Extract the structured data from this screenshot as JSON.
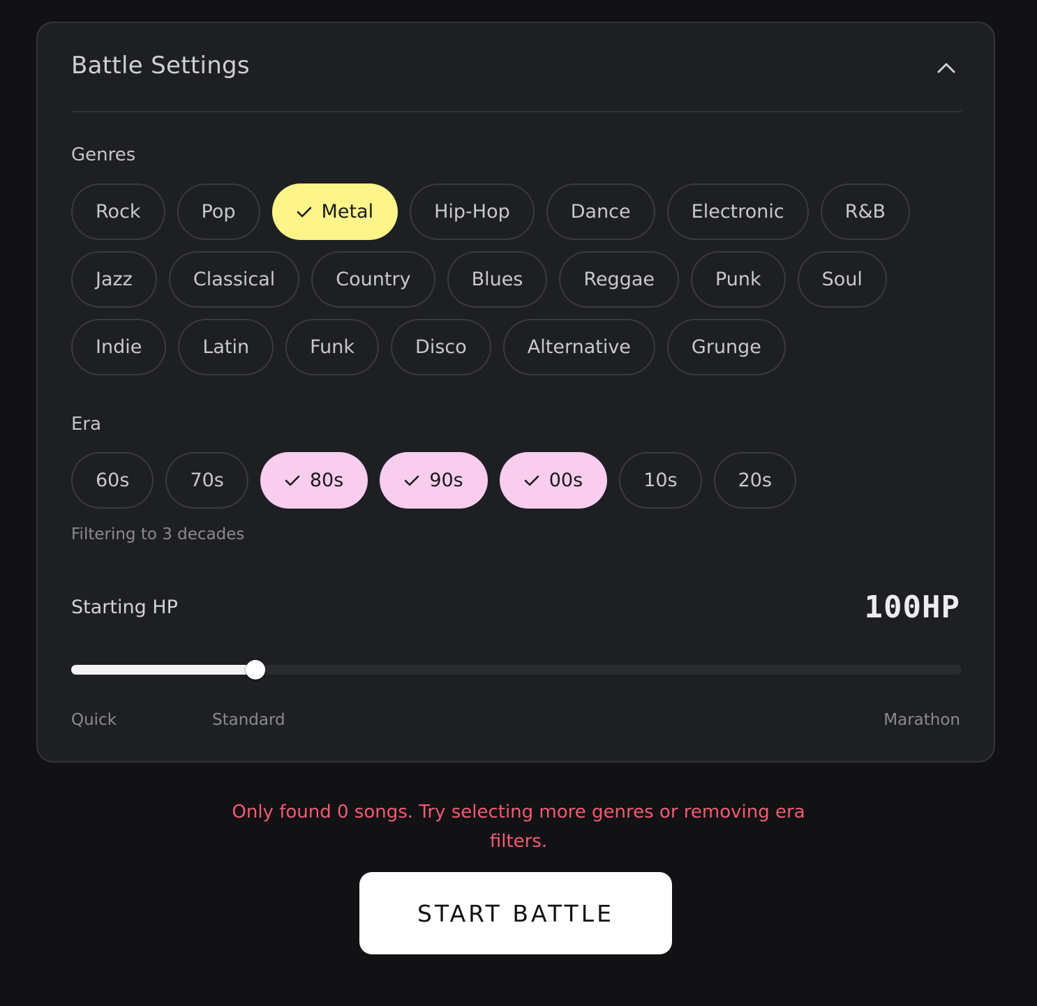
{
  "settings": {
    "title": "Battle Settings",
    "collapse_icon": "chevron-up-icon"
  },
  "genres": {
    "label": "Genres",
    "rows": [
      [
        {
          "label": "Rock",
          "selected": false
        },
        {
          "label": "Pop",
          "selected": false
        },
        {
          "label": "Metal",
          "selected": true
        },
        {
          "label": "Hip-Hop",
          "selected": false
        },
        {
          "label": "Dance",
          "selected": false
        },
        {
          "label": "Electronic",
          "selected": false
        },
        {
          "label": "R&B",
          "selected": false
        }
      ],
      [
        {
          "label": "Jazz",
          "selected": false
        },
        {
          "label": "Classical",
          "selected": false
        },
        {
          "label": "Country",
          "selected": false
        },
        {
          "label": "Blues",
          "selected": false
        },
        {
          "label": "Reggae",
          "selected": false
        },
        {
          "label": "Punk",
          "selected": false
        },
        {
          "label": "Soul",
          "selected": false
        }
      ],
      [
        {
          "label": "Indie",
          "selected": false
        },
        {
          "label": "Latin",
          "selected": false
        },
        {
          "label": "Funk",
          "selected": false
        },
        {
          "label": "Disco",
          "selected": false
        },
        {
          "label": "Alternative",
          "selected": false
        },
        {
          "label": "Grunge",
          "selected": false
        }
      ]
    ],
    "selected_color": "#fdf48a"
  },
  "era": {
    "label": "Era",
    "options": [
      {
        "label": "60s",
        "selected": false
      },
      {
        "label": "70s",
        "selected": false
      },
      {
        "label": "80s",
        "selected": true
      },
      {
        "label": "90s",
        "selected": true
      },
      {
        "label": "00s",
        "selected": true
      },
      {
        "label": "10s",
        "selected": false
      },
      {
        "label": "20s",
        "selected": false
      }
    ],
    "hint": "Filtering to 3 decades",
    "selected_color": "#f8cdee"
  },
  "hp": {
    "label": "Starting HP",
    "value_text": "100HP",
    "slider_fraction": 0.207,
    "ticks": [
      "Quick",
      "Standard",
      "Marathon"
    ]
  },
  "error_message": "Only found 0 songs. Try selecting more genres or removing era filters.",
  "error_color": "#ef5c74",
  "start_button": {
    "label": "START BATTLE"
  }
}
